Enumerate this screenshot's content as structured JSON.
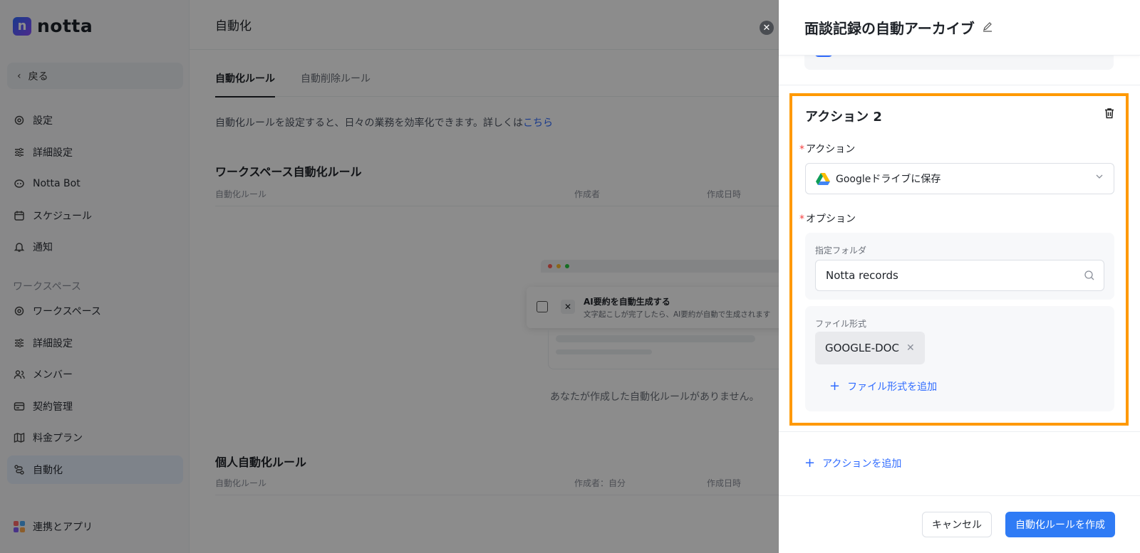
{
  "app": {
    "logo_text": "notta",
    "logo_letter": "n"
  },
  "sidebar": {
    "back_label": "戻る",
    "items_top": [
      {
        "label": "設定",
        "icon": "gear-icon"
      },
      {
        "label": "詳細設定",
        "icon": "sliders-icon"
      },
      {
        "label": "Notta Bot",
        "icon": "bot-icon"
      },
      {
        "label": "スケジュール",
        "icon": "calendar-icon"
      },
      {
        "label": "通知",
        "icon": "bell-icon"
      }
    ],
    "section_label": "ワークスペース",
    "items_ws": [
      {
        "label": "ワークスペース",
        "icon": "gear-icon"
      },
      {
        "label": "詳細設定",
        "icon": "sliders-icon"
      },
      {
        "label": "メンバー",
        "icon": "users-icon"
      },
      {
        "label": "契約管理",
        "icon": "card-icon"
      },
      {
        "label": "料金プラン",
        "icon": "map-icon"
      },
      {
        "label": "自動化",
        "icon": "automation-icon"
      }
    ],
    "integrations_label": "連携とアプリ"
  },
  "main": {
    "title": "自動化",
    "tabs": [
      "自動化ルール",
      "自動削除ルール"
    ],
    "description": "自動化ルールを設定すると、日々の業務を効率化できます。詳しくは",
    "description_link": "こちら",
    "workspace_section": {
      "title": "ワークスペース自動化ルール",
      "columns": [
        "自動化ルール",
        "作成者",
        "作成日時"
      ]
    },
    "empty_card": {
      "title": "AI要約を自動生成する",
      "subtitle": "文字起こしが完了したら、AI要約が自動で生成されます"
    },
    "empty_text": "あなたが作成した自動化ルールがありません。",
    "personal_section": {
      "title": "個人自動化ルール",
      "columns": [
        "自動化ルール",
        "作成者：自分",
        "作成日時"
      ]
    }
  },
  "drawer": {
    "title": "面談記録の自動アーカイブ",
    "action_title": "アクション 2",
    "action_label": "アクション",
    "action_value": "Googleドライブに保存",
    "option_label": "オプション",
    "folder_label": "指定フォルダ",
    "folder_value": "Notta records",
    "format_label": "ファイル形式",
    "format_chip": "GOOGLE-DOC",
    "add_format": "ファイル形式を追加",
    "add_action": "アクションを追加",
    "cancel": "キャンセル",
    "create": "自動化ルールを作成"
  },
  "colors": {
    "accent": "#2f7bf5",
    "highlight": "#ff9900",
    "required": "#f53f3f"
  }
}
